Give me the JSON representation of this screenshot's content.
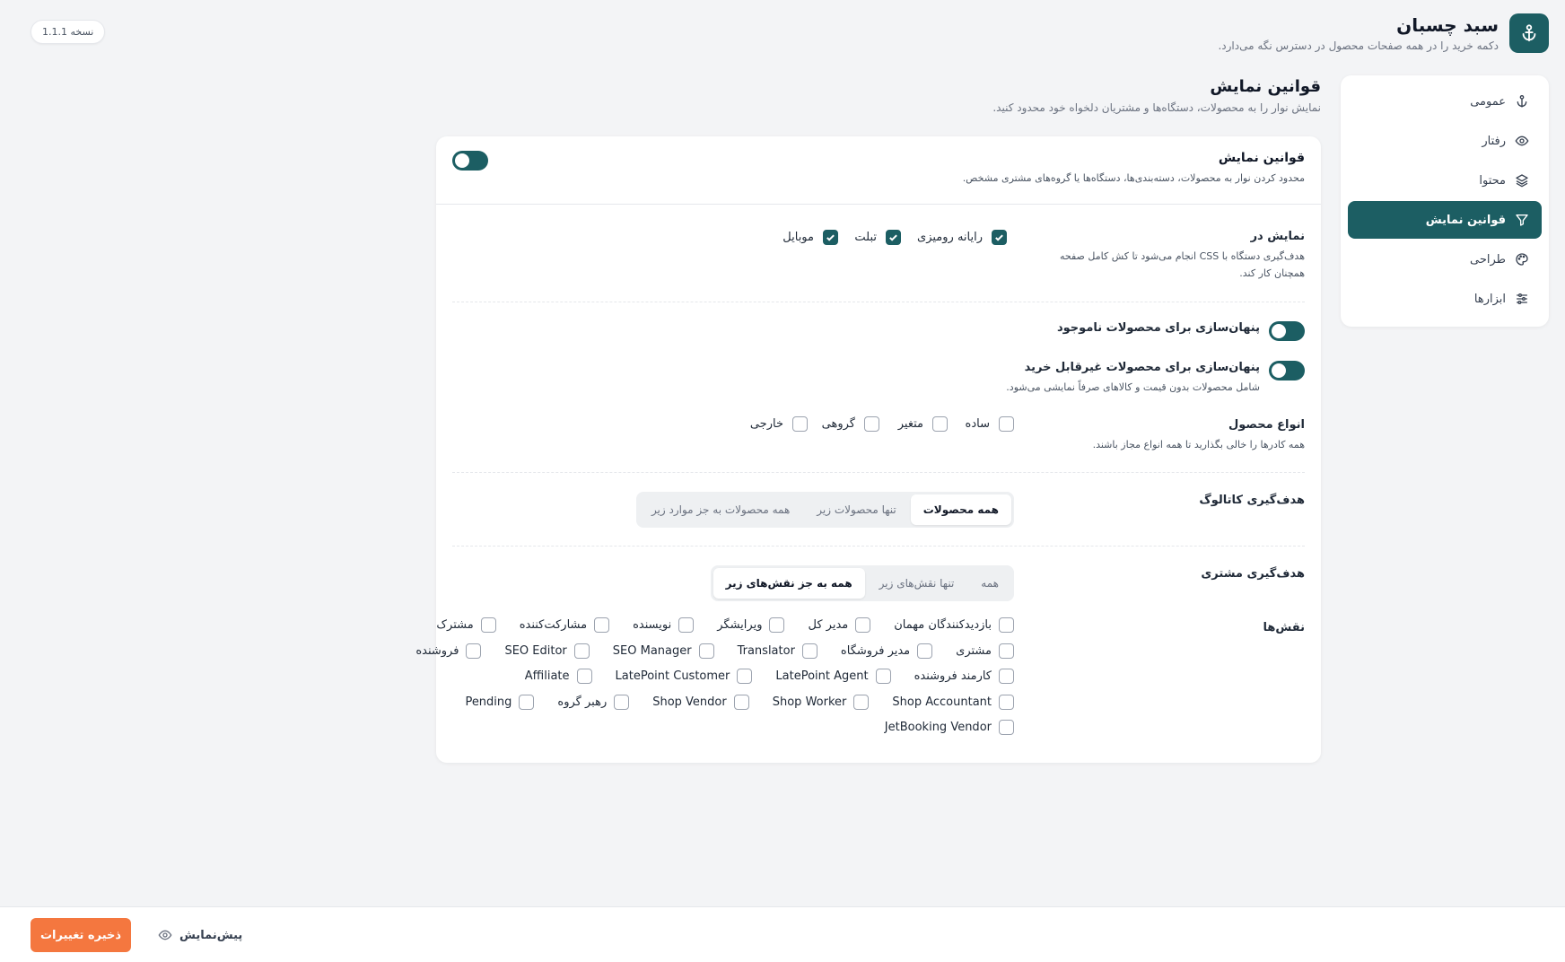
{
  "app": {
    "title": "سبد چسبان",
    "subtitle": "دکمه خرید را در همه صفحات محصول در دسترس نگه می‌دارد.",
    "version": "نسخه 1.1.1"
  },
  "colors": {
    "primary": "#1c5e63",
    "accent": "#f4773f",
    "background": "#f3f4f6"
  },
  "sidebar": {
    "items": [
      {
        "label": "عمومی",
        "icon": "anchor-icon"
      },
      {
        "label": "رفتار",
        "icon": "eye-icon"
      },
      {
        "label": "محتوا",
        "icon": "layers-icon"
      },
      {
        "label": "قوانین نمایش",
        "icon": "filter-icon",
        "active": true
      },
      {
        "label": "طراحی",
        "icon": "palette-icon"
      },
      {
        "label": "ابزارها",
        "icon": "sliders-icon"
      }
    ]
  },
  "page": {
    "title": "قوانین نمایش",
    "description": "نمایش نوار را به محصولات، دستگاه‌ها و مشتریان دلخواه خود محدود کنید."
  },
  "card": {
    "title": "قوانین نمایش",
    "description": "محدود کردن نوار به محصولات، دسته‌بندی‌ها، دستگاه‌ها یا گروه‌های مشتری مشخص.",
    "enabled": true
  },
  "devices": {
    "label": "نمایش در",
    "help": "هدف‌گیری دستگاه با CSS انجام می‌شود تا کش کامل صفحه همچنان کار کند.",
    "options": [
      {
        "label": "رایانه رومیزی",
        "checked": true
      },
      {
        "label": "تبلت",
        "checked": true
      },
      {
        "label": "موبایل",
        "checked": true
      }
    ]
  },
  "hide_out_of_stock": {
    "label": "پنهان‌سازی برای محصولات ناموجود",
    "enabled": true
  },
  "hide_unpurchasable": {
    "label": "پنهان‌سازی برای محصولات غیرقابل خرید",
    "help": "شامل محصولات بدون قیمت و کالاهای صرفاً نمایشی می‌شود.",
    "enabled": true
  },
  "product_types": {
    "label": "انواع محصول",
    "help": "همه کادرها را خالی بگذارید تا همه انواع مجاز باشند.",
    "options": [
      {
        "label": "ساده",
        "checked": false
      },
      {
        "label": "متغیر",
        "checked": false
      },
      {
        "label": "گروهی",
        "checked": false
      },
      {
        "label": "خارجی",
        "checked": false
      }
    ]
  },
  "catalog_targeting": {
    "label": "هدف‌گیری کاتالوگ",
    "options": [
      "همه محصولات",
      "تنها محصولات زیر",
      "همه محصولات به جز موارد زیر"
    ],
    "selected": "همه محصولات"
  },
  "customer_targeting": {
    "label": "هدف‌گیری مشتری",
    "options": [
      "همه",
      "تنها نقش‌های زیر",
      "همه به جز نقش‌های زیر"
    ],
    "selected": "همه به جز نقش‌های زیر"
  },
  "roles": {
    "label": "نقش‌ها",
    "rows": [
      [
        "بازدیدکنندگان مهمان",
        "مدیر کل",
        "ویرایشگر",
        "نویسنده",
        "مشارکت‌کننده",
        "مشترک"
      ],
      [
        "مشتری",
        "مدیر فروشگاه",
        "Translator",
        "SEO Manager",
        "SEO Editor",
        "فروشنده"
      ],
      [
        "کارمند فروشنده",
        "LatePoint Agent",
        "LatePoint Customer",
        "Affiliate"
      ],
      [
        "Shop Accountant",
        "Shop Worker",
        "Shop Vendor",
        "رهبر گروه",
        "Pending"
      ],
      [
        "JetBooking Vendor"
      ]
    ]
  },
  "footer": {
    "save_label": "ذخیره تغییرات",
    "preview_label": "پیش‌نمایش"
  }
}
